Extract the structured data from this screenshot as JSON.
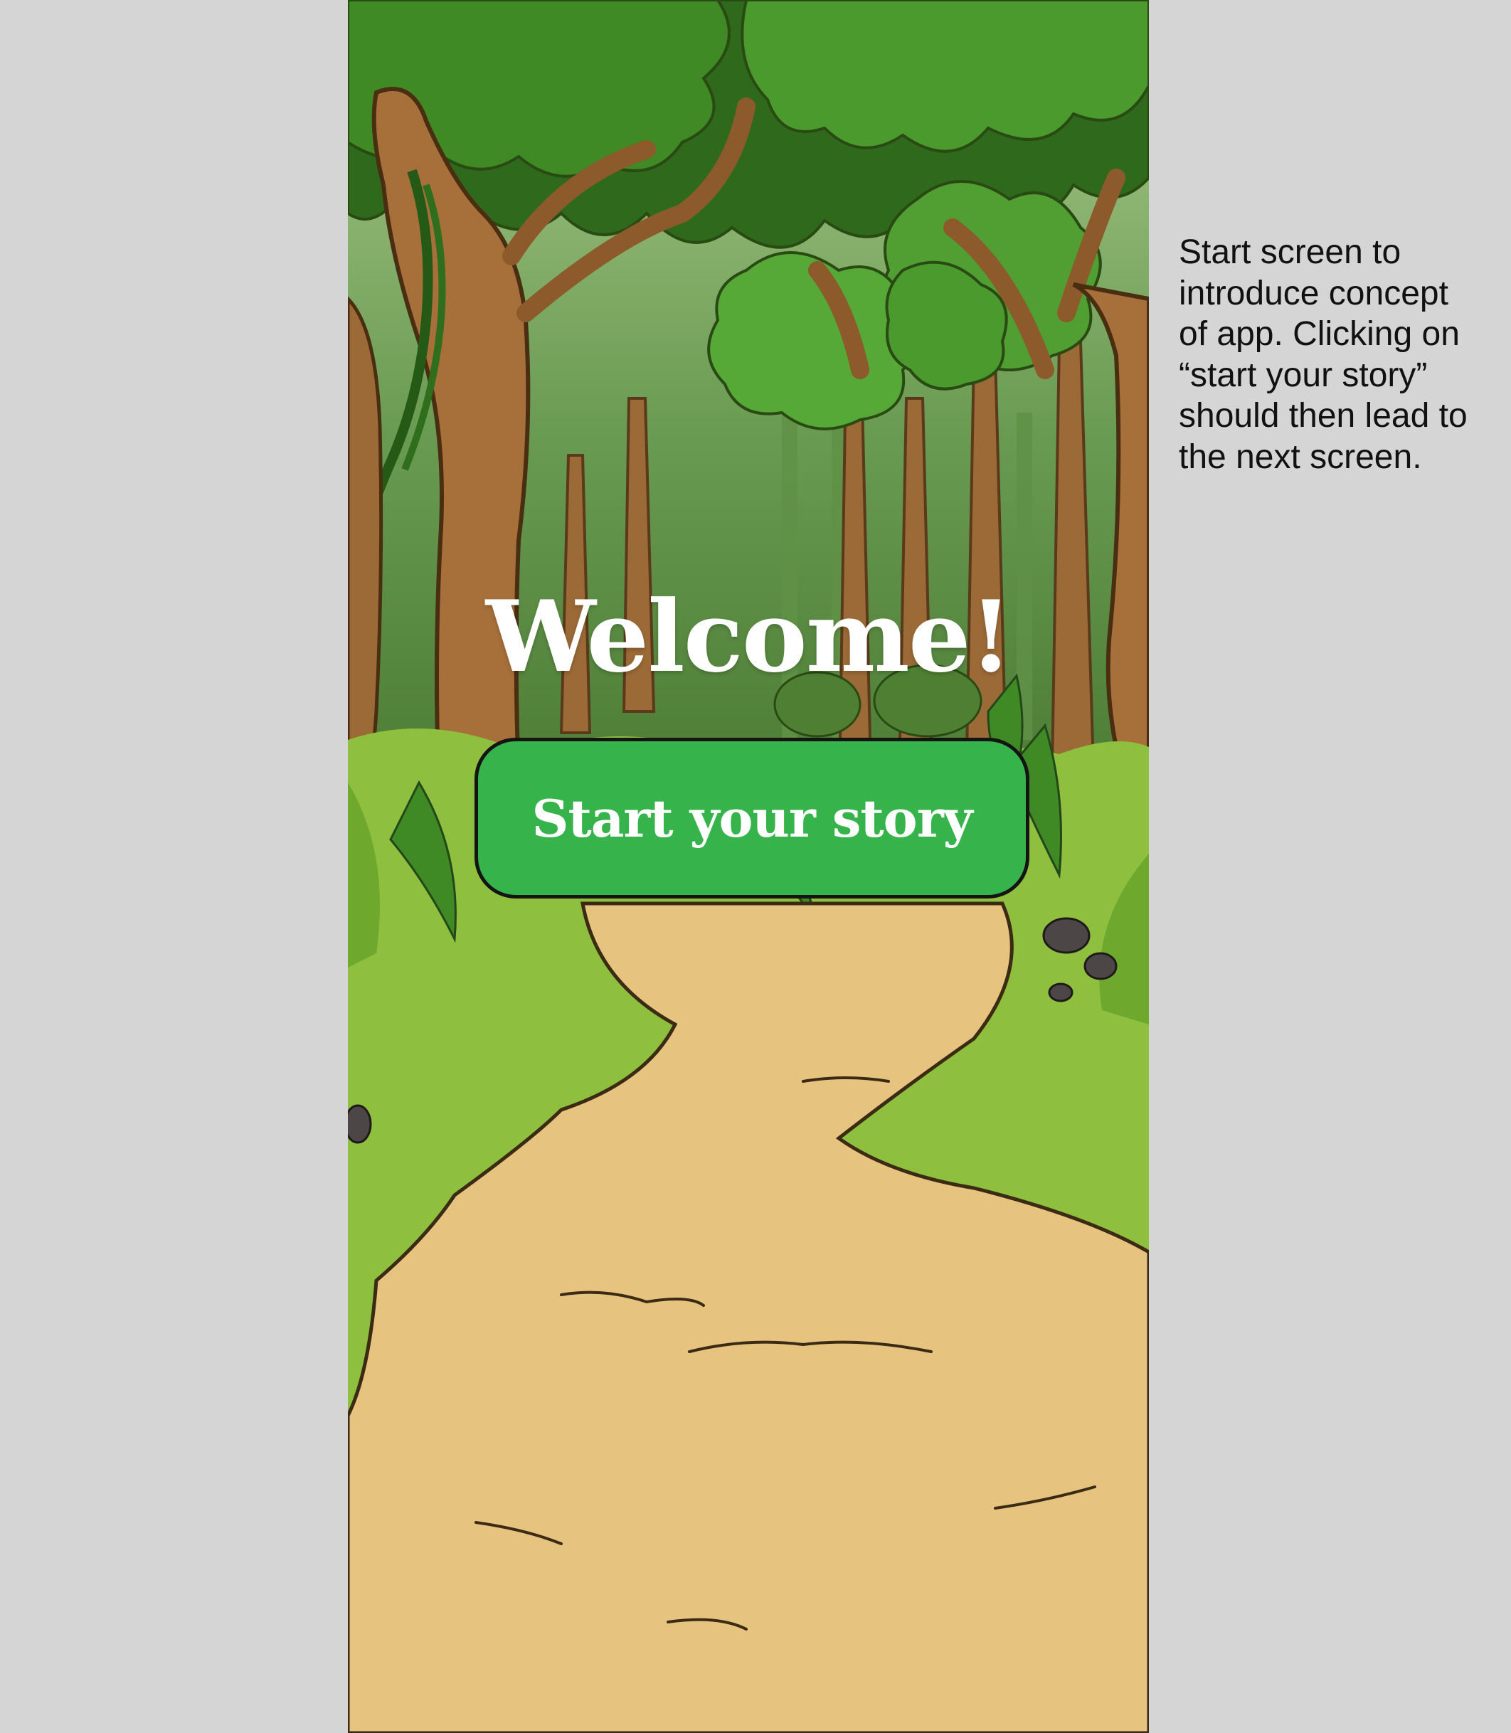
{
  "screen": {
    "welcome_text": "Welcome!",
    "start_button_label": "Start your story"
  },
  "annotation": {
    "note": "Start screen to\nintroduce concept\nof app. Clicking on\n“start your story”\nshould then lead to\nthe next screen."
  },
  "colors": {
    "page_background": "#d5d5d5",
    "button_fill": "#36b34b",
    "button_border": "#141414",
    "path_sand": "#e6c37e",
    "grass": "#8fbf3f",
    "foliage_dark": "#3f7a21",
    "tree_trunk": "#a7703a"
  }
}
